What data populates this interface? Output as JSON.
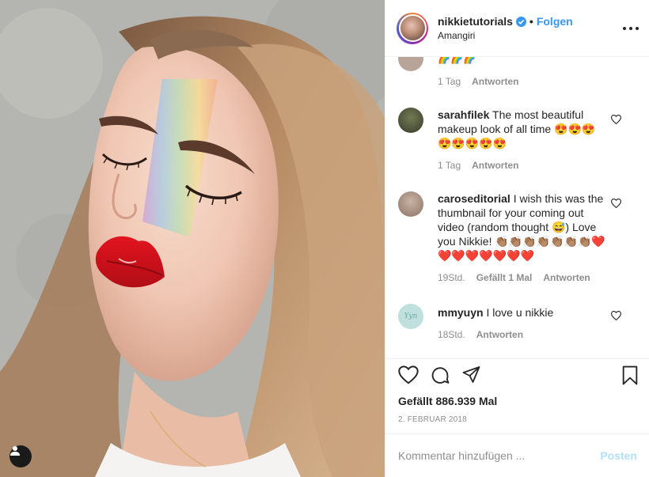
{
  "post": {
    "author": "nikkietutorials",
    "verified": true,
    "follow_label": "Folgen",
    "separator": "•",
    "location": "Amangiri",
    "likes_text": "Gefällt 886.939 Mal",
    "date": "2. FEBRUAR 2018"
  },
  "comments": [
    {
      "user": "",
      "text": "🌈🌈🌈",
      "time": "1 Tag",
      "likes": "",
      "reply": "Antworten"
    },
    {
      "user": "sarahfilek",
      "text": "The most beautiful makeup look of all time 😍😍😍😍😍😍😍😍",
      "time": "1 Tag",
      "likes": "",
      "reply": "Antworten"
    },
    {
      "user": "caroseditorial",
      "text": "I wish this was the thumbnail for your coming out video (random thought 😅) Love you Nikkie! 👏🏽👏🏽👏🏽👏🏽👏🏽👏🏽👏🏽❤️❤️❤️❤️❤️❤️❤️❤️",
      "time": "19Std.",
      "likes": "Gefällt 1 Mal",
      "reply": "Antworten"
    },
    {
      "user": "mmyuyn",
      "text": "I love u nikkie",
      "time": "18Std.",
      "likes": "",
      "reply": "Antworten"
    }
  ],
  "avatar_text": {
    "mmyuyn": "Yyn"
  },
  "add_comment": {
    "placeholder": "Kommentar hinzufügen ...",
    "post_label": "Posten"
  },
  "icons": {
    "verified": "verified-badge-icon",
    "more": "more-options-icon",
    "like": "heart-icon",
    "comment": "comment-icon",
    "share": "share-icon",
    "save": "bookmark-icon",
    "tag": "user-tag-icon"
  },
  "colors": {
    "link": "#3897f0",
    "post_disabled": "#b2dffc",
    "verified": "#3897f0",
    "lips": "#d8121c"
  }
}
